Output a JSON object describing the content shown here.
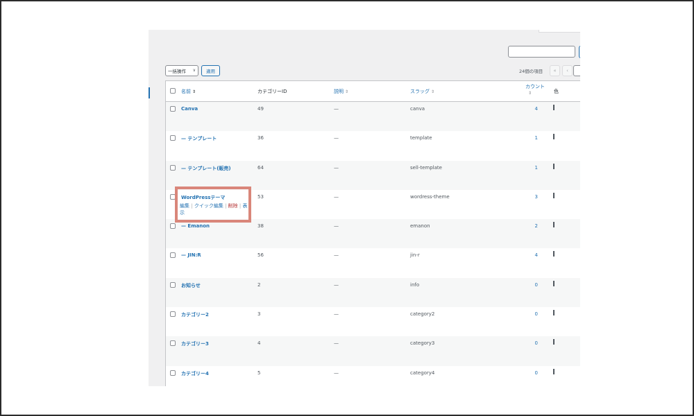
{
  "toolbar": {
    "bulk_action": "一括操作",
    "apply": "適用",
    "items_count": "24個の項目",
    "first_page": "«",
    "prev_page": "‹"
  },
  "columns": {
    "name": "名前",
    "category_id": "カテゴリーID",
    "description": "説明",
    "slug": "スラッグ",
    "count": "カウント",
    "color": "色"
  },
  "rows": [
    {
      "name": "Canva",
      "id": "49",
      "desc": "—",
      "slug": "canva",
      "count": "4"
    },
    {
      "name": "— テンプレート",
      "id": "36",
      "desc": "—",
      "slug": "template",
      "count": "1"
    },
    {
      "name": "— テンプレート(販売)",
      "id": "64",
      "desc": "—",
      "slug": "sell-template",
      "count": "1"
    },
    {
      "name": "WordPressテーマ",
      "id": "53",
      "desc": "—",
      "slug": "wordress-theme",
      "count": "3"
    },
    {
      "name": "— Emanon",
      "id": "38",
      "desc": "—",
      "slug": "emanon",
      "count": "2"
    },
    {
      "name": "— JIN:R",
      "id": "56",
      "desc": "—",
      "slug": "jin-r",
      "count": "4"
    },
    {
      "name": "お知らせ",
      "id": "2",
      "desc": "—",
      "slug": "info",
      "count": "0"
    },
    {
      "name": "カテゴリー2",
      "id": "3",
      "desc": "—",
      "slug": "category2",
      "count": "0"
    },
    {
      "name": "カテゴリー3",
      "id": "4",
      "desc": "—",
      "slug": "category3",
      "count": "0"
    },
    {
      "name": "カテゴリー4",
      "id": "5",
      "desc": "—",
      "slug": "category4",
      "count": "0"
    }
  ],
  "row_actions": {
    "edit": "編集",
    "quick_edit": "クイック編集",
    "delete": "削除",
    "view_1": "表",
    "view_2": "示",
    "sep": "|"
  },
  "colors": {
    "link": "#2271b1",
    "delete": "#b32d2e",
    "highlight": "#d9867a"
  }
}
